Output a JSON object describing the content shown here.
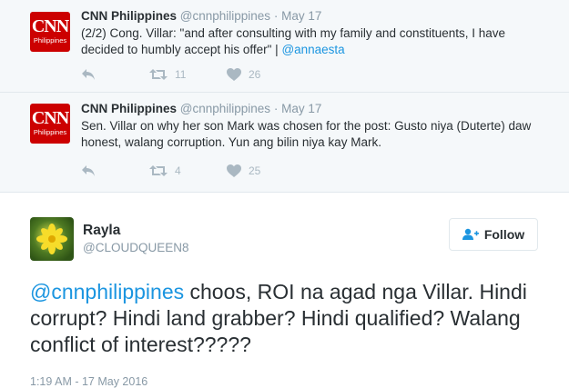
{
  "quoted_tweets": [
    {
      "author": "CNN Philippines",
      "handle": "@cnnphilippines",
      "date": "May 17",
      "text_before": "(2/2) Cong. Villar: \"and after consulting with my family and constituents, I have decided to humbly accept his offer\" | ",
      "mention": "@annaesta",
      "retweets": "11",
      "likes": "26",
      "logo_big": "CNN",
      "logo_small": "Philippines"
    },
    {
      "author": "CNN Philippines",
      "handle": "@cnnphilippines",
      "date": "May 17",
      "text_before": "Sen. Villar on why her son Mark was chosen for the post: Gusto niya (Duterte) daw honest, walang corruption. Yun ang bilin niya kay Mark.",
      "mention": "",
      "retweets": "4",
      "likes": "25",
      "logo_big": "CNN",
      "logo_small": "Philippines"
    }
  ],
  "main_tweet": {
    "name": "Rayla",
    "handle": "@CLOUDQUEEN8",
    "follow_label": "Follow",
    "mention": "@cnnphilippines",
    "text": " choos, ROI na agad nga Villar. Hindi corrupt? Hindi land grabber? Hindi qualified? Walang conflict of interest?????",
    "timestamp": "1:19 AM - 17 May 2016"
  },
  "colors": {
    "accent": "#1b95e0",
    "cnn_red": "#cc0000",
    "muted": "#8899a6",
    "icon_gray": "#aab8c2"
  }
}
